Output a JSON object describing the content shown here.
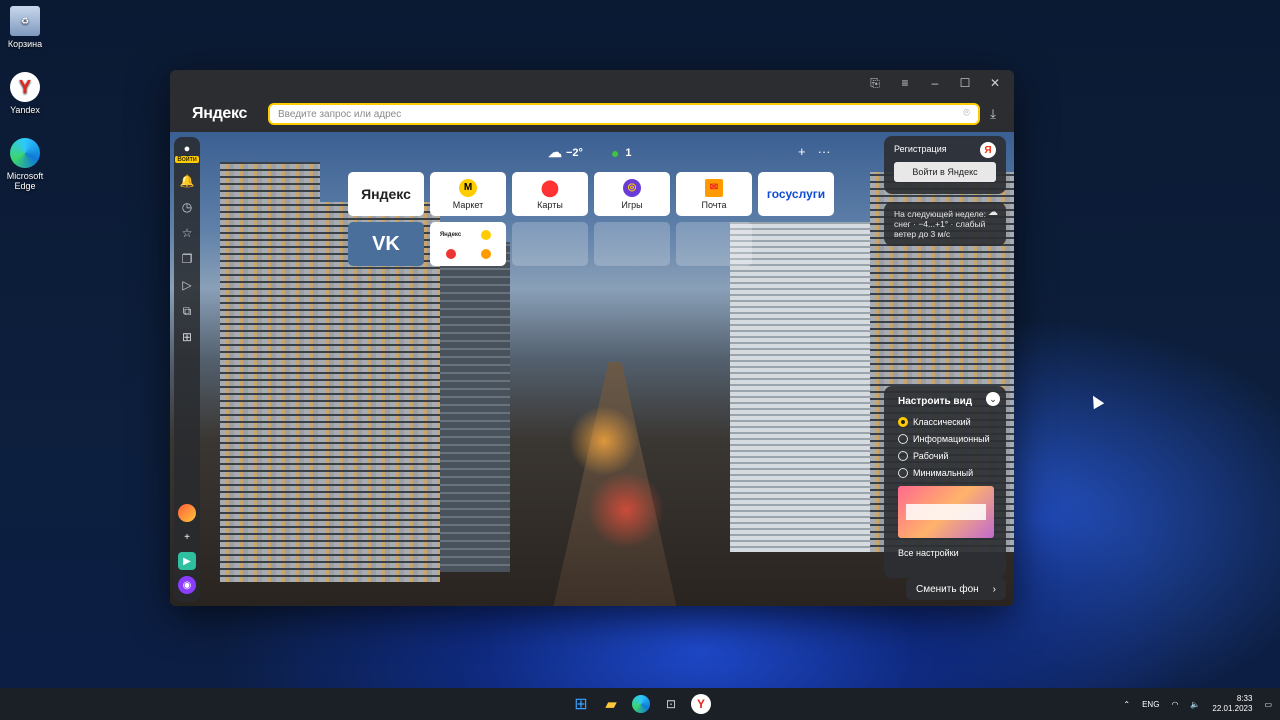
{
  "desktop": {
    "icons": [
      {
        "label": "Корзина",
        "icon": "recycle-bin-icon"
      },
      {
        "label": "Yandex",
        "icon": "yandex-browser-icon"
      },
      {
        "label": "Microsoft Edge",
        "icon": "edge-icon"
      }
    ]
  },
  "browser": {
    "logo": "Яндекс",
    "address": {
      "placeholder": "Введите запрос или адрес"
    },
    "sidebar": {
      "user_label": "Войти"
    },
    "weather": {
      "temp": "−2°",
      "traffic": "1"
    },
    "tiles": [
      {
        "label": "",
        "text": "Яндекс",
        "kind": "yandex"
      },
      {
        "label": "Маркет",
        "text": "",
        "kind": "market"
      },
      {
        "label": "Карты",
        "text": "",
        "kind": "maps"
      },
      {
        "label": "Игры",
        "text": "",
        "kind": "games"
      },
      {
        "label": "Почта",
        "text": "",
        "kind": "mail"
      },
      {
        "label": "",
        "text": "госуслуги",
        "kind": "gosuslugi"
      },
      {
        "label": "",
        "text": "VK",
        "kind": "vk"
      },
      {
        "label": "",
        "text": "Яндекс",
        "kind": "group"
      },
      {
        "label": "",
        "text": "",
        "kind": "empty"
      },
      {
        "label": "",
        "text": "",
        "kind": "empty"
      },
      {
        "label": "",
        "text": "",
        "kind": "empty"
      }
    ],
    "account": {
      "title": "Регистрация",
      "login_button": "Войти в Яндекс"
    },
    "forecast": {
      "text": "На следующей неделе: снег · −4...+1° · слабый ветер до 3 м/с"
    },
    "view_settings": {
      "title": "Настроить вид",
      "options": [
        {
          "label": "Классический",
          "selected": true
        },
        {
          "label": "Информационный",
          "selected": false
        },
        {
          "label": "Рабочий",
          "selected": false
        },
        {
          "label": "Минимальный",
          "selected": false
        }
      ],
      "all_settings": "Все настройки"
    },
    "change_bg": "Сменить фон"
  },
  "taskbar": {
    "lang": "ENG",
    "time": "8:33",
    "date": "22.01.2023"
  }
}
